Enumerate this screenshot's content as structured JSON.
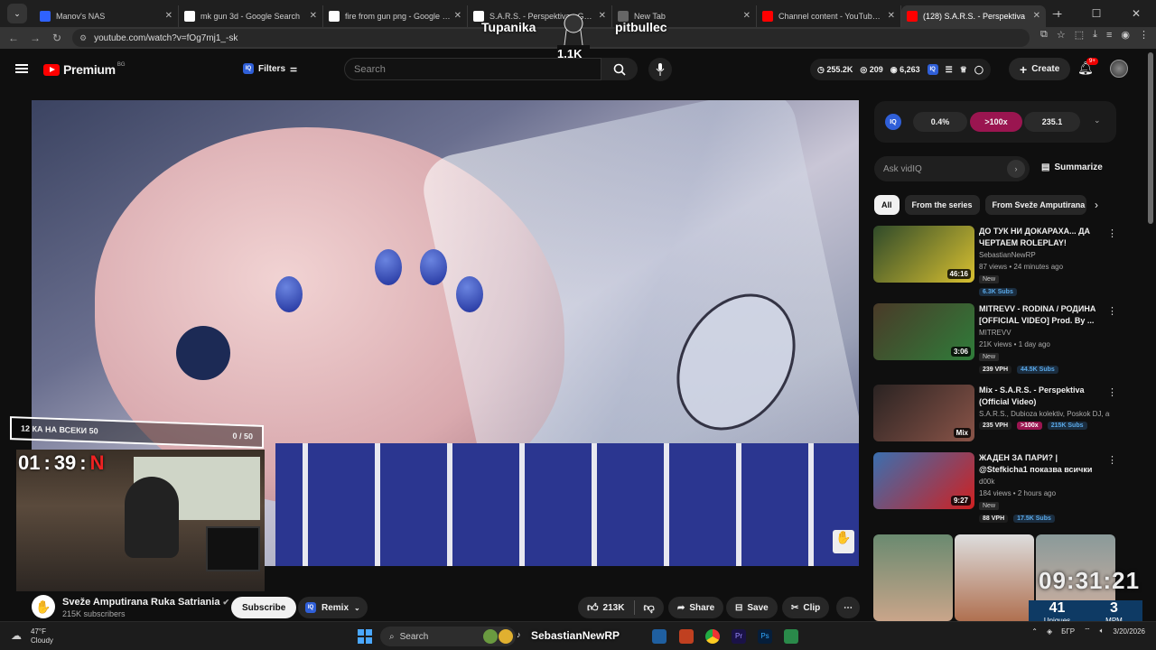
{
  "browser": {
    "tabs": [
      {
        "label": "Manov's NAS",
        "fav": "#2f62ff"
      },
      {
        "label": "mk gun 3d - Google Search",
        "fav": "#ffffff"
      },
      {
        "label": "fire from gun png - Google Se",
        "fav": "#ffffff"
      },
      {
        "label": "S.A.R.S. - Perspektiva - Googl",
        "fav": "#ffffff"
      },
      {
        "label": "New Tab",
        "fav": "#666666"
      },
      {
        "label": "Channel content - YouTube Stu",
        "fav": "#ff0000"
      },
      {
        "label": "(128) S.A.R.S. - Perspektiva",
        "fav": "#ff0000"
      }
    ],
    "url": "youtube.com/watch?v=fOg7mj1_-sk"
  },
  "stream_overlay": {
    "left_name": "Tupanika",
    "right_name": "pitbullec",
    "badge": "1.1K",
    "goal_label": "12 КА НА ВСЕКИ 50",
    "goal_progress": "0 / 50",
    "timer_h": "01",
    "timer_m": "39",
    "timer_s": "N",
    "clock": "09:31:21",
    "uniques_value": "41",
    "uniques_label": "Uniques",
    "mpm_value": "3",
    "mpm_label": "MPM"
  },
  "header": {
    "logo_text": "Premium",
    "logo_region": "BG",
    "filters_label": "Filters",
    "search_placeholder": "Search",
    "stat_views": "255.2K",
    "stat_videos": "209",
    "stat_subs": "6,263",
    "create_label": "Create",
    "notif_count": "9+"
  },
  "vidiq": {
    "pill1": "0.4%",
    "pill2": ">100x",
    "pill3": "235.1",
    "ask_placeholder": "Ask vidIQ",
    "summarize_label": "Summarize"
  },
  "chips": [
    "All",
    "From the series",
    "From Sveže Amputirana R"
  ],
  "recommendations": [
    {
      "title": "ДО ТУК НИ ДОКАРАХА... ДА ЧЕРТАЕМ ROLEPLAY!",
      "channel": "SebastianNewRP",
      "meta": "87 views • 24 minutes ago",
      "badge": "New",
      "duration": "46:16",
      "vph": "",
      "score": "",
      "subs": "6.3K Subs",
      "colors": [
        "#2f4a2a",
        "#d8c030"
      ]
    },
    {
      "title": "MITREVV - RODINA / РОДИНА [OFFICIAL VIDEO] Prod. By ...",
      "channel": "MITREVV",
      "meta": "21K views • 1 day ago",
      "badge": "New",
      "duration": "3:06",
      "vph": "239 VPH",
      "score": "",
      "subs": "44.5K Subs",
      "colors": [
        "#4a3a28",
        "#2f7d3a"
      ]
    },
    {
      "title": "Mix - S.A.R.S. - Perspektiva (Official Video)",
      "channel": "S.A.R.S., Dubioza kolektiv, Poskok DJ, an...",
      "meta": "",
      "badge": "",
      "duration": "Mix",
      "vph": "235 VPH",
      "score": ">100x",
      "subs": "215K Subs",
      "colors": [
        "#2a2322",
        "#8a5448"
      ]
    },
    {
      "title": "ЖАДЕН ЗА ПАРИ? | @Stefkicha1 показва всички ...",
      "channel": "d00k",
      "meta": "184 views • 2 hours ago",
      "badge": "New",
      "duration": "9:27",
      "vph": "88 VPH",
      "score": "",
      "subs": "17.5K Subs",
      "colors": [
        "#3a6fb0",
        "#d02020"
      ]
    }
  ],
  "channel": {
    "name": "Sveže Amputirana Ruka Satriania",
    "subs": "215K subscribers",
    "subscribe_label": "Subscribe",
    "remix_label": "Remix",
    "likes": "213K",
    "share_label": "Share",
    "save_label": "Save",
    "clip_label": "Clip"
  },
  "taskbar": {
    "temp": "47°F",
    "weather": "Cloudy",
    "search_label": "Search",
    "running_label": "SebastianNewRP",
    "lang": "БГР",
    "date": "3/20/2026"
  }
}
